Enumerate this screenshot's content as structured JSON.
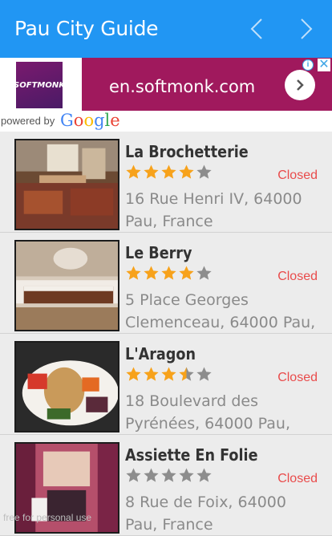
{
  "app": {
    "title": "Pau City Guide",
    "prev_icon": "chevron-left-icon",
    "next_icon": "chevron-right-icon",
    "accent": "#2196f3"
  },
  "ad": {
    "logo_text": "SOFTMONK",
    "domain": "en.softmonk.com",
    "background": "#a0195d",
    "info_label": "i",
    "close_label": "✕"
  },
  "powered": {
    "text": "powered by",
    "brand": "Google"
  },
  "places": [
    {
      "name": "La Brochetterie",
      "rating": 4,
      "status": "Closed",
      "address": "16 Rue Henri IV, 64000 Pau, France"
    },
    {
      "name": "Le Berry",
      "rating": 4,
      "status": "Closed",
      "address": "5 Place Georges Clemenceau, 64000 Pau,"
    },
    {
      "name": "L'Aragon",
      "rating": 3.5,
      "status": "Closed",
      "address": "18 Boulevard des Pyrénées, 64000 Pau,"
    },
    {
      "name": "Assiette En Folie",
      "rating": 0,
      "status": "Closed",
      "address": "8 Rue de Foix, 64000 Pau, France"
    }
  ],
  "watermark": "free for personal use"
}
